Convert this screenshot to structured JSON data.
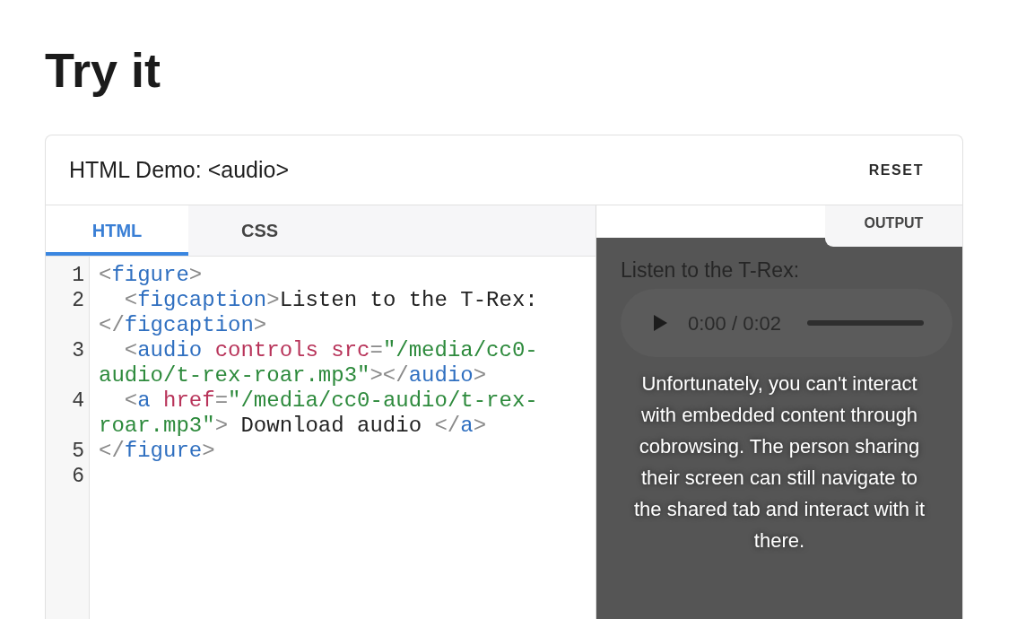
{
  "page": {
    "heading": "Try it"
  },
  "demo": {
    "title": "HTML Demo: <audio>",
    "reset_button": "RESET",
    "editor": {
      "tabs": [
        {
          "label": "HTML",
          "selected": true
        },
        {
          "label": "CSS",
          "selected": false
        }
      ],
      "lines": [
        {
          "number": "1",
          "rows": [
            {
              "tokens": [
                {
                  "kind": "punct",
                  "text": "<"
                },
                {
                  "kind": "tag",
                  "text": "figure"
                },
                {
                  "kind": "punct",
                  "text": ">"
                }
              ]
            }
          ]
        },
        {
          "number": "2",
          "rows": [
            {
              "tokens": [
                {
                  "kind": "punct",
                  "text": "  <"
                },
                {
                  "kind": "tag",
                  "text": "figcaption"
                },
                {
                  "kind": "punct",
                  "text": ">"
                },
                {
                  "kind": "text",
                  "text": "Listen to the T-Rex:"
                }
              ]
            },
            {
              "tokens": [
                {
                  "kind": "punct",
                  "text": "</"
                },
                {
                  "kind": "tag",
                  "text": "figcaption"
                },
                {
                  "kind": "punct",
                  "text": ">"
                }
              ]
            }
          ]
        },
        {
          "number": "3",
          "rows": [
            {
              "tokens": [
                {
                  "kind": "punct",
                  "text": "  <"
                },
                {
                  "kind": "tag",
                  "text": "audio"
                },
                {
                  "kind": "attr",
                  "text": " controls"
                },
                {
                  "kind": "attr",
                  "text": " src"
                },
                {
                  "kind": "punct",
                  "text": "="
                },
                {
                  "kind": "string",
                  "text": "\"/media/cc0-"
                }
              ]
            },
            {
              "tokens": [
                {
                  "kind": "string",
                  "text": "audio/t-rex-roar.mp3\""
                },
                {
                  "kind": "punct",
                  "text": "></"
                },
                {
                  "kind": "tag",
                  "text": "audio"
                },
                {
                  "kind": "punct",
                  "text": ">"
                }
              ]
            }
          ]
        },
        {
          "number": "4",
          "rows": [
            {
              "tokens": [
                {
                  "kind": "punct",
                  "text": "  <"
                },
                {
                  "kind": "tag",
                  "text": "a"
                },
                {
                  "kind": "attr",
                  "text": " href"
                },
                {
                  "kind": "punct",
                  "text": "="
                },
                {
                  "kind": "string",
                  "text": "\"/media/cc0-audio/t-rex-"
                }
              ]
            },
            {
              "tokens": [
                {
                  "kind": "string",
                  "text": "roar.mp3\""
                },
                {
                  "kind": "punct",
                  "text": ">"
                },
                {
                  "kind": "text",
                  "text": " Download audio "
                },
                {
                  "kind": "punct",
                  "text": "</"
                },
                {
                  "kind": "tag",
                  "text": "a"
                },
                {
                  "kind": "punct",
                  "text": ">"
                }
              ]
            }
          ]
        },
        {
          "number": "5",
          "rows": [
            {
              "tokens": [
                {
                  "kind": "punct",
                  "text": "</"
                },
                {
                  "kind": "tag",
                  "text": "figure"
                },
                {
                  "kind": "punct",
                  "text": ">"
                }
              ]
            }
          ]
        },
        {
          "number": "6"
        }
      ]
    },
    "output": {
      "tab": "OUTPUT",
      "caption": "Listen to the T-Rex:",
      "player": {
        "time": "0:00 / 0:02"
      },
      "notice": "Unfortunately, you can't interact with embedded content through cobrowsing. The person sharing their screen can still navigate to the shared tab and interact with it there."
    }
  }
}
